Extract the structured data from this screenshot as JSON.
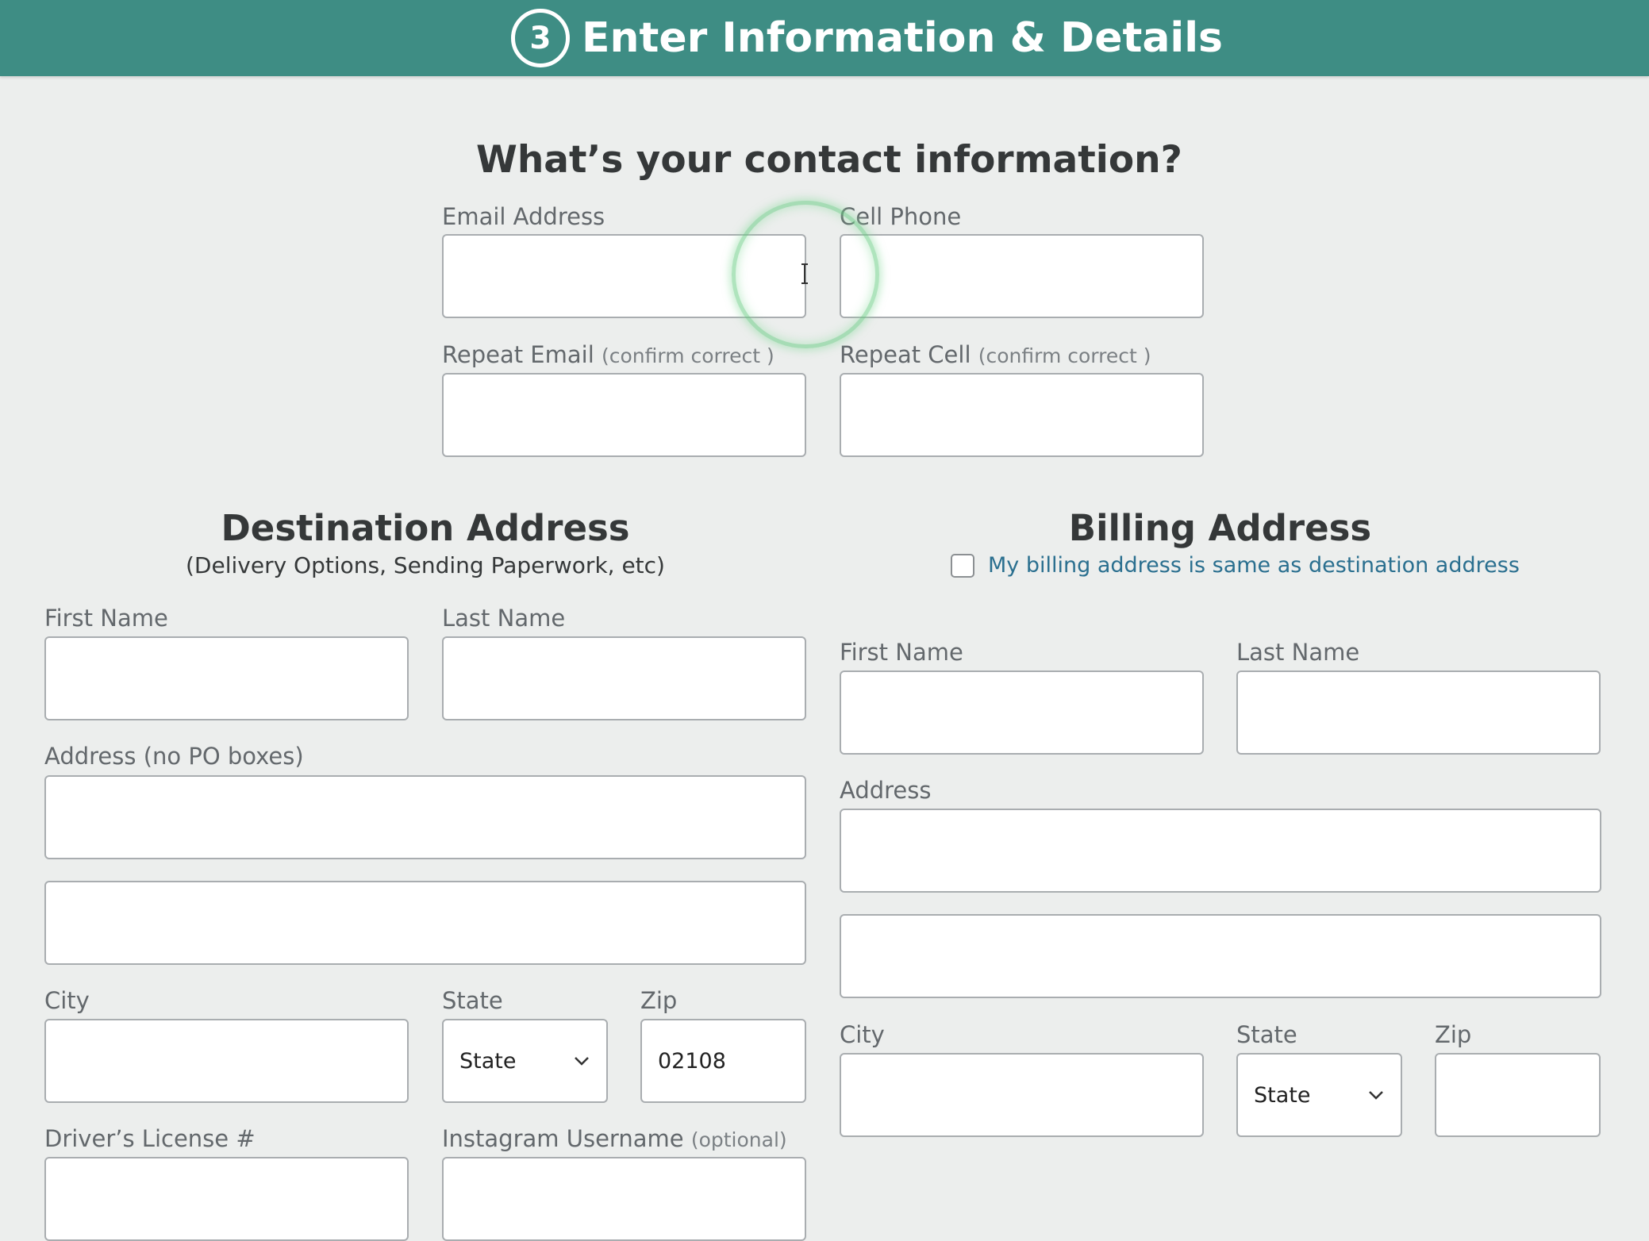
{
  "header": {
    "step": "3",
    "title": "Enter Information & Details",
    "bg_color": "#3e8d84"
  },
  "contact": {
    "title": "What’s your contact information?",
    "email_label": "Email Address",
    "cell_label": "Cell Phone",
    "repeat_email_label": "Repeat Email",
    "repeat_cell_label": "Repeat Cell",
    "confirm_hint": "(confirm correct )"
  },
  "destination": {
    "title": "Destination Address",
    "subtitle": "(Delivery Options, Sending Paperwork, etc)",
    "first_name_label": "First Name",
    "last_name_label": "Last Name",
    "address_label": "Address (no PO boxes)",
    "city_label": "City",
    "state_label": "State",
    "state_value": "State",
    "zip_label": "Zip",
    "zip_value": "02108",
    "license_label": "Driver’s License #",
    "instagram_label": "Instagram Username",
    "optional_hint": "(optional)"
  },
  "billing": {
    "title": "Billing Address",
    "same_as_label": "My billing address is same as destination address",
    "first_name_label": "First Name",
    "last_name_label": "Last Name",
    "address_label": "Address",
    "city_label": "City",
    "state_label": "State",
    "state_value": "State",
    "zip_label": "Zip",
    "zip_value": ""
  },
  "colors": {
    "link": "#2a6f8f",
    "click_indicator": "#6ecd87"
  },
  "icons": [
    "chevron-down-icon",
    "text-cursor-icon"
  ]
}
